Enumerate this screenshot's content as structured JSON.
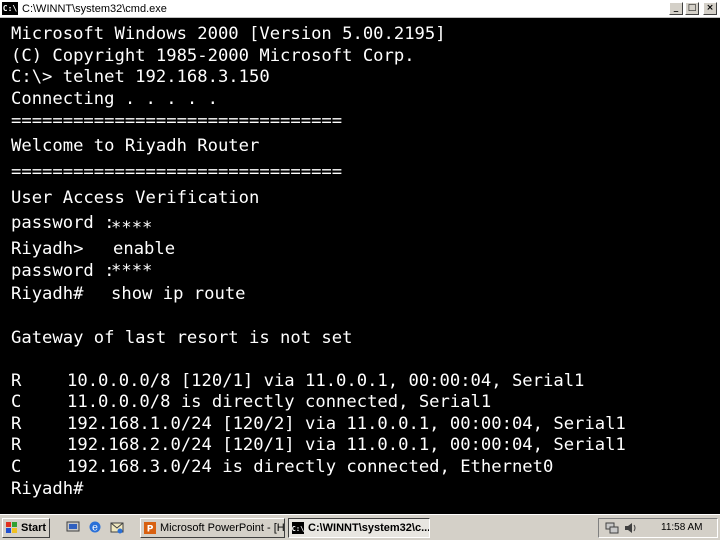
{
  "window": {
    "icon_text": "C:\\",
    "title": "C:\\WINNT\\system32\\cmd.exe",
    "minimize_symbol": "_",
    "maximize_symbol": "□",
    "close_symbol": "×"
  },
  "console": {
    "lines": [
      "Microsoft Windows 2000 [Version 5.00.2195]",
      "(C) Copyright 1985-2000 Microsoft Corp.",
      "C:\\> telnet 192.168.3.150",
      "Connecting . . . . .",
      "================================",
      "Welcome to Riyadh Router",
      "================================",
      "User Access Verification"
    ],
    "auth": {
      "password_label_1": "password :",
      "password_mask_1": "****",
      "prompt_1": "Riyadh>",
      "command_1": "enable",
      "password_label_2": "password :",
      "password_mask_2": "****",
      "prompt_2": "Riyadh#",
      "command_2": "show ip route"
    },
    "gateway_line": "Gateway of last resort is not set",
    "routes": [
      {
        "code": "R",
        "text": "10.0.0.0/8 [120/1] via 11.0.0.1, 00:00:04, Serial1"
      },
      {
        "code": "C",
        "text": "11.0.0.0/8 is directly connected, Serial1"
      },
      {
        "code": "R",
        "text": "192.168.1.0/24 [120/2] via 11.0.0.1, 00:00:04, Serial1"
      },
      {
        "code": "R",
        "text": "192.168.2.0/24 [120/1] via 11.0.0.1, 00:00:04, Serial1"
      },
      {
        "code": "C",
        "text": "192.168.3.0/24 is directly connected, Ethernet0"
      }
    ],
    "final_prompt": "Riyadh#"
  },
  "taskbar": {
    "start_label": "Start",
    "quick_launch_icons": [
      "show-desktop-icon",
      "internet-explorer-icon",
      "outlook-express-icon"
    ],
    "tasks": [
      {
        "label": "Microsoft PowerPoint - [H...",
        "icon": "powerpoint-icon",
        "active": false
      },
      {
        "label": "C:\\WINNT\\system32\\c...",
        "icon": "cmd-icon",
        "active": true
      }
    ],
    "tray_icons": [
      "network-icon",
      "volume-icon"
    ],
    "clock": "11:58 AM"
  }
}
